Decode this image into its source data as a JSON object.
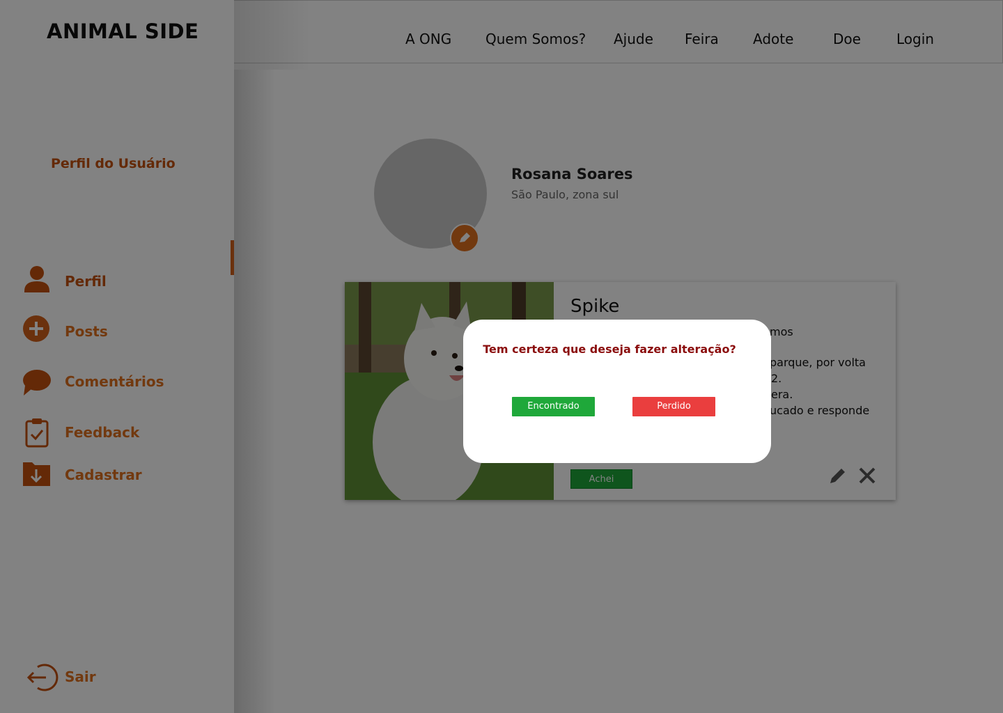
{
  "header": {
    "logo": "ANIMAL SIDE",
    "nav": [
      "A ONG",
      "Quem Somos?",
      "Ajude",
      "Feira",
      "Adote",
      "Doe",
      "Login"
    ]
  },
  "sidebar": {
    "title": "Perfil do Usuário",
    "items": [
      {
        "label": "Perfil",
        "icon": "user-icon"
      },
      {
        "label": "Posts",
        "icon": "plus-circle-icon"
      },
      {
        "label": "Comentários",
        "icon": "chat-bubble-icon"
      },
      {
        "label": "Feedback",
        "icon": "clipboard-check-icon"
      },
      {
        "label": "Cadastrar",
        "icon": "folder-download-icon"
      }
    ],
    "logout_label": "Sair",
    "accent": "#e0701f"
  },
  "profile": {
    "name": "Rosana Soares",
    "location": "São Paulo, zona sul"
  },
  "post": {
    "title": "Spike",
    "visible_fragments": [
      "mos",
      "parque, por volta",
      "2.",
      "era.",
      "ucado e responde"
    ],
    "achei_label": "Achei"
  },
  "modal": {
    "question": "Tem certeza que deseja fazer alteração?",
    "found_label": "Encontrado",
    "lost_label": "Perdido",
    "found_color": "#1fa83a",
    "lost_color": "#ea3e3e"
  }
}
